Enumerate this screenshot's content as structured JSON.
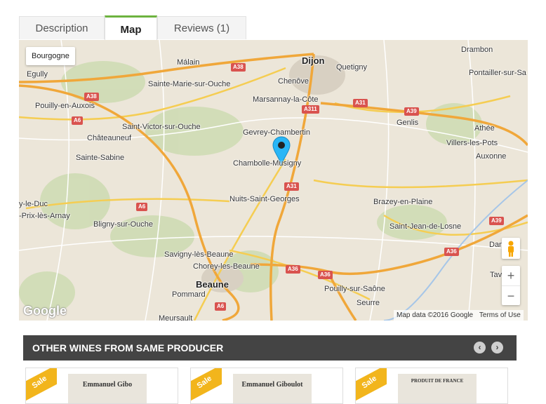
{
  "tabs": [
    {
      "label": "Description"
    },
    {
      "label": "Map",
      "active": true
    },
    {
      "label": "Reviews (1)"
    }
  ],
  "map": {
    "region_label": "Bourgogne",
    "places": [
      {
        "name": "Dijon",
        "big": true
      },
      {
        "name": "Drambon"
      },
      {
        "name": "Quetigny"
      },
      {
        "name": "Málain"
      },
      {
        "name": "Egully"
      },
      {
        "name": "Chenôve"
      },
      {
        "name": "Pontailler-sur-Sa"
      },
      {
        "name": "Sainte-Marie-sur-Ouche"
      },
      {
        "name": "Pouilly-en-Auxois"
      },
      {
        "name": "Marsannay-la-Côte"
      },
      {
        "name": "Genlis"
      },
      {
        "name": "Saint-Victor-sur-Ouche"
      },
      {
        "name": "Athée"
      },
      {
        "name": "Châteauneuf"
      },
      {
        "name": "Gevrey-Chambertin"
      },
      {
        "name": "Villers-les-Pots"
      },
      {
        "name": "Sainte-Sabine"
      },
      {
        "name": "Chambolle-Musigny"
      },
      {
        "name": "Auxonne"
      },
      {
        "name": "Nuits-Saint-Georges"
      },
      {
        "name": "Brazey-en-Plaine"
      },
      {
        "name": "y-le-Duc"
      },
      {
        "name": "-Prix-lès-Arnay"
      },
      {
        "name": "Bligny-sur-Ouche"
      },
      {
        "name": "Saint-Jean-de-Losne"
      },
      {
        "name": "Savigny-lès-Beaune"
      },
      {
        "name": "Chorey-les-Beaune"
      },
      {
        "name": "Beaune",
        "big": true
      },
      {
        "name": "Pommard"
      },
      {
        "name": "Pouilly-sur-Saône"
      },
      {
        "name": "Seurre"
      },
      {
        "name": "Meursault"
      },
      {
        "name": "Tav"
      },
      {
        "name": "Dan"
      }
    ],
    "roads": [
      "A38",
      "A38",
      "A6",
      "A311",
      "A31",
      "A39",
      "A31",
      "A6",
      "A39",
      "A36",
      "A36",
      "A36",
      "A6"
    ],
    "attribution": "Map data ©2016 Google",
    "terms": "Terms of Use",
    "logo": "Google",
    "zoom_in": "+",
    "zoom_out": "−",
    "marker_color": "#29b6f6"
  },
  "other_wines": {
    "title": "OTHER WINES FROM SAME PRODUCER",
    "prev": "‹",
    "next": "›",
    "cards": [
      {
        "badge": "Sale",
        "label_text": "Emmanuel Gibo"
      },
      {
        "badge": "Sale",
        "label_text": "Emmanuel Giboulot"
      },
      {
        "badge": "Sale",
        "label_text": "PRODUIT DE FRANCE"
      }
    ]
  },
  "colors": {
    "accent": "#6db33f",
    "bar": "#444444",
    "sale": "#f2b51c",
    "shield": "#d9534f"
  }
}
